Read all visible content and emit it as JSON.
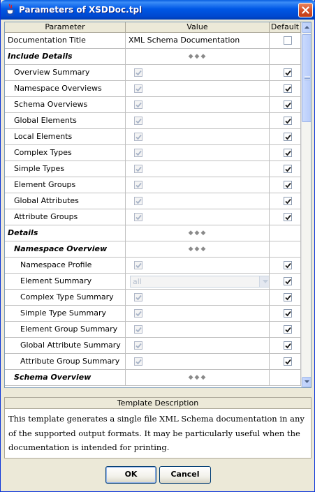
{
  "window": {
    "title": "Parameters of XSDDoc.tpl"
  },
  "table": {
    "headers": {
      "parameter": "Parameter",
      "value": "Value",
      "default": "Default"
    },
    "rows": [
      {
        "name": "Documentation Title",
        "level": 0,
        "kind": "text",
        "value": "XML Schema Documentation",
        "default_checked": false
      },
      {
        "name": "Include Details",
        "level": 0,
        "kind": "group"
      },
      {
        "name": "Overview Summary",
        "level": 1,
        "kind": "checkbox",
        "value_checked": true,
        "default_checked": true
      },
      {
        "name": "Namespace Overviews",
        "level": 1,
        "kind": "checkbox",
        "value_checked": true,
        "default_checked": true
      },
      {
        "name": "Schema Overviews",
        "level": 1,
        "kind": "checkbox",
        "value_checked": true,
        "default_checked": true
      },
      {
        "name": "Global Elements",
        "level": 1,
        "kind": "checkbox",
        "value_checked": true,
        "default_checked": true
      },
      {
        "name": "Local Elements",
        "level": 1,
        "kind": "checkbox",
        "value_checked": true,
        "default_checked": true
      },
      {
        "name": "Complex Types",
        "level": 1,
        "kind": "checkbox",
        "value_checked": true,
        "default_checked": true
      },
      {
        "name": "Simple Types",
        "level": 1,
        "kind": "checkbox",
        "value_checked": true,
        "default_checked": true
      },
      {
        "name": "Element Groups",
        "level": 1,
        "kind": "checkbox",
        "value_checked": true,
        "default_checked": true
      },
      {
        "name": "Global Attributes",
        "level": 1,
        "kind": "checkbox",
        "value_checked": true,
        "default_checked": true
      },
      {
        "name": "Attribute Groups",
        "level": 1,
        "kind": "checkbox",
        "value_checked": true,
        "default_checked": true
      },
      {
        "name": "Details",
        "level": 0,
        "kind": "group"
      },
      {
        "name": "Namespace Overview",
        "level": 1,
        "kind": "group"
      },
      {
        "name": "Namespace Profile",
        "level": 2,
        "kind": "checkbox",
        "value_checked": true,
        "default_checked": true
      },
      {
        "name": "Element Summary",
        "level": 2,
        "kind": "combo",
        "value": "all",
        "default_checked": true
      },
      {
        "name": "Complex Type Summary",
        "level": 2,
        "kind": "checkbox",
        "value_checked": true,
        "default_checked": true
      },
      {
        "name": "Simple Type Summary",
        "level": 2,
        "kind": "checkbox",
        "value_checked": true,
        "default_checked": true
      },
      {
        "name": "Element Group Summary",
        "level": 2,
        "kind": "checkbox",
        "value_checked": true,
        "default_checked": true
      },
      {
        "name": "Global Attribute Summary",
        "level": 2,
        "kind": "checkbox",
        "value_checked": true,
        "default_checked": true
      },
      {
        "name": "Attribute Group Summary",
        "level": 2,
        "kind": "checkbox",
        "value_checked": true,
        "default_checked": true
      },
      {
        "name": "Schema Overview",
        "level": 1,
        "kind": "group"
      }
    ]
  },
  "description": {
    "header": "Template Description",
    "text": "This template generates a single file XML Schema documentation in any of the supported output formats. It may be particularly useful when the documentation is intended for printing."
  },
  "buttons": {
    "ok": "OK",
    "cancel": "Cancel"
  },
  "icons": {
    "title": "java-cup-icon",
    "close": "close-icon",
    "group_marker": "diamonds-icon"
  },
  "colors": {
    "titlebar": "#0058e6",
    "close": "#d6532b",
    "grid": "#c0c0c0",
    "panel": "#ece9d8"
  }
}
